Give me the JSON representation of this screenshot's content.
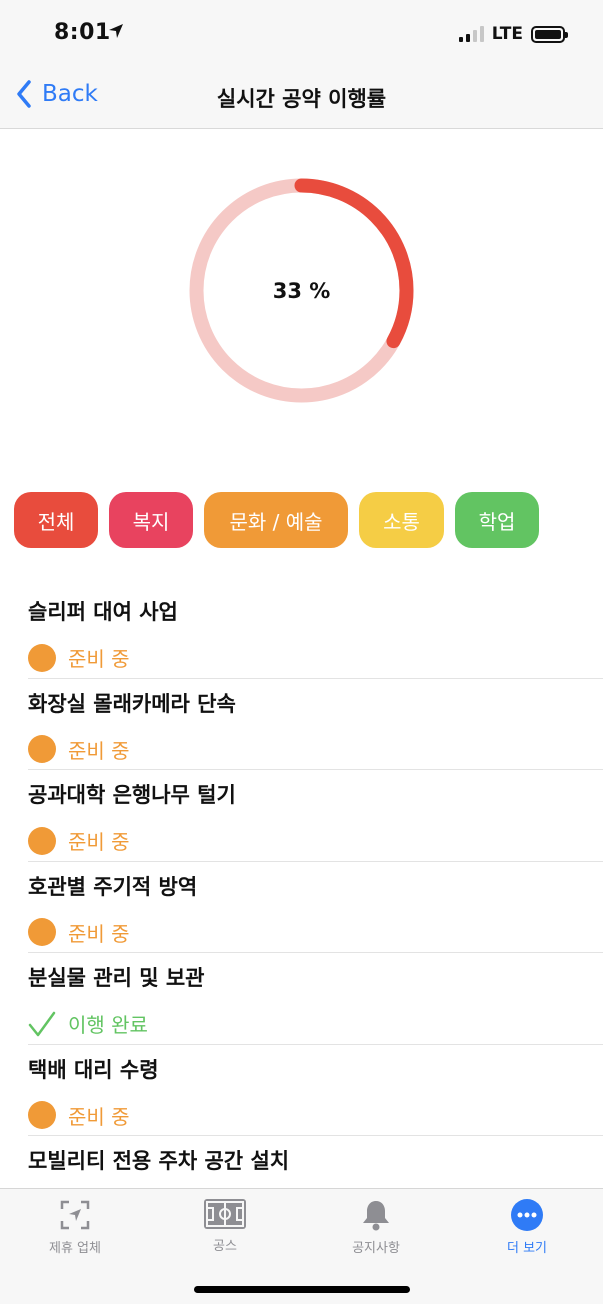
{
  "status_bar": {
    "time": "8:01",
    "network": "LTE",
    "icons": [
      "location-arrow-icon",
      "signal-icon",
      "battery-icon"
    ]
  },
  "nav": {
    "back_label": "Back",
    "title": "실시간 공약 이행률"
  },
  "progress": {
    "label": "33 %",
    "fraction": 0.33,
    "track_color": "#f5c9c6",
    "fill_color": "#e84c3d"
  },
  "categories": [
    {
      "label": "전체",
      "color": "#e84c3d"
    },
    {
      "label": "복지",
      "color": "#e8435f"
    },
    {
      "label": "문화 / 예술",
      "color": "#f09a37"
    },
    {
      "label": "소통",
      "color": "#f5cd45"
    },
    {
      "label": "학업",
      "color": "#62c462"
    }
  ],
  "pledges": [
    {
      "title": "슬리퍼 대여 사업",
      "status": "준비 중",
      "state": "preparing"
    },
    {
      "title": "화장실 몰래카메라 단속",
      "status": "준비 중",
      "state": "preparing"
    },
    {
      "title": "공과대학 은행나무 털기",
      "status": "준비 중",
      "state": "preparing"
    },
    {
      "title": "호관별 주기적 방역",
      "status": "준비 중",
      "state": "preparing"
    },
    {
      "title": "분실물 관리 및 보관",
      "status": "이행 완료",
      "state": "done"
    },
    {
      "title": "택배 대리 수령",
      "status": "준비 중",
      "state": "preparing"
    },
    {
      "title": "모빌리티 전용 주차 공간 설치",
      "status": "",
      "state": "partial"
    }
  ],
  "status_colors": {
    "preparing": "#f09a37",
    "done": "#62c462"
  },
  "tabs": [
    {
      "label": "제휴 업체",
      "icon": "map-scan-icon"
    },
    {
      "label": "공스",
      "icon": "soccer-field-icon"
    },
    {
      "label": "공지사항",
      "icon": "bell-icon"
    },
    {
      "label": "더 보기",
      "icon": "more-circle-icon",
      "active": true
    }
  ]
}
